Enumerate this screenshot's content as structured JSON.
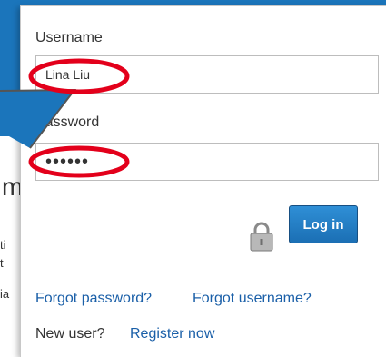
{
  "background": {
    "heading_fragment": "m",
    "text_fragment_1": "ti",
    "text_fragment_2": "t",
    "text_fragment_3": "ia"
  },
  "login": {
    "username_label": "Username",
    "username_value": "Lina Liu",
    "password_label": "Password",
    "password_value": "••••••",
    "login_button": "Log in",
    "forgot_password": "Forgot password?",
    "forgot_username": "Forgot username?",
    "new_user_text": "New user?",
    "register_link": "Register now"
  },
  "icons": {
    "lock": "lock-icon"
  },
  "colors": {
    "accent": "#1b75bb",
    "link": "#1a5fa8",
    "annotation": "#e3001b"
  }
}
